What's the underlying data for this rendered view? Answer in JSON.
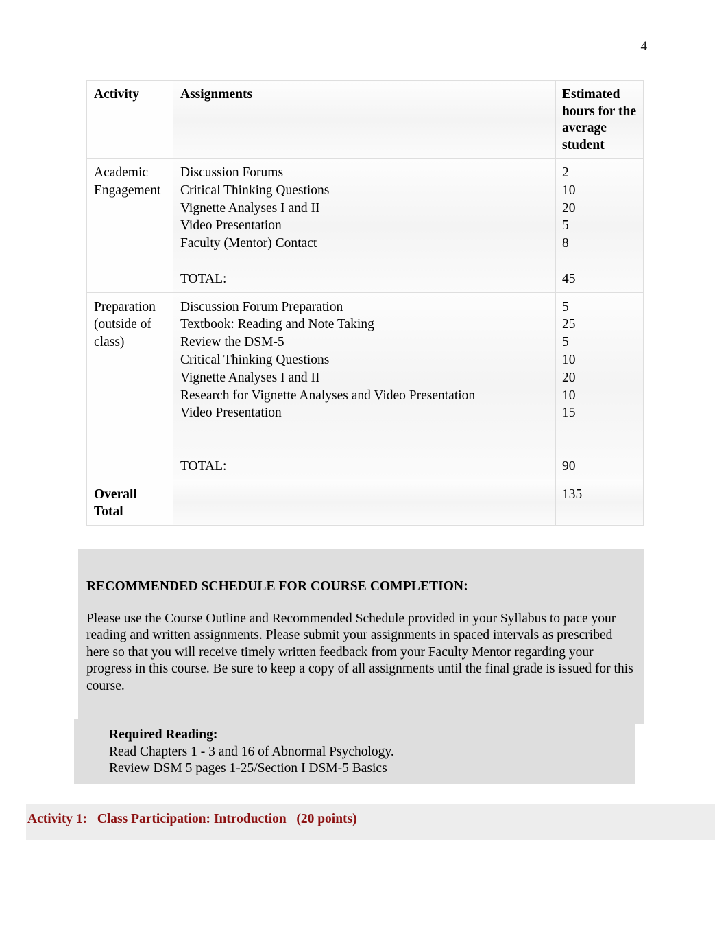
{
  "page": {
    "number": "4"
  },
  "workload_table": {
    "headers": {
      "activity": "Activity",
      "assignments": "Assignments",
      "hours": "Estimated hours for the average student"
    },
    "sections": [
      {
        "activity": "Academic Engagement",
        "bold": false,
        "rows": [
          {
            "assignment": "Discussion Forums",
            "hours": "2"
          },
          {
            "assignment": "Critical Thinking Questions",
            "hours": "10"
          },
          {
            "assignment": "Vignette Analyses I and II",
            "hours": "20"
          },
          {
            "assignment": "Video Presentation",
            "hours": "5"
          },
          {
            "assignment": "Faculty (Mentor) Contact",
            "hours": "8"
          }
        ],
        "total_label": "TOTAL:",
        "total_hours": "45"
      },
      {
        "activity": "Preparation (outside of class)",
        "bold": false,
        "rows": [
          {
            "assignment": "Discussion Forum Preparation",
            "hours": "5"
          },
          {
            "assignment": "Textbook: Reading and Note Taking",
            "hours": "25"
          },
          {
            "assignment": "Review the DSM-5",
            "hours": "5"
          },
          {
            "assignment": "Critical Thinking Questions",
            "hours": "10"
          },
          {
            "assignment": "Vignette Analyses I and II",
            "hours": "20"
          },
          {
            "assignment": "Research for Vignette Analyses and Video Presentation",
            "hours": "10"
          },
          {
            "assignment": "Video Presentation",
            "hours": "15"
          }
        ],
        "total_label": "TOTAL:",
        "total_hours": "90"
      }
    ],
    "overall": {
      "label": "Overall Total",
      "assignments": "",
      "hours": "135"
    }
  },
  "schedule": {
    "heading": "RECOMMENDED SCHEDULE FOR COURSE COMPLETION:",
    "paragraph": "Please use the Course Outline and Recommended Schedule provided in your Syllabus to pace your reading and written assignments.  Please submit your assignments in spaced intervals as prescribed here so that you will receive timely written feedback from your Faculty Mentor regarding your progress in this course. Be sure to keep a copy of all assignments until the final grade is issued for this course."
  },
  "required_reading": {
    "title": "Required Reading:",
    "line1": "Read Chapters 1 - 3 and 16 of Abnormal Psychology.",
    "line2": "Review DSM 5 pages 1-25/Section I DSM-5 Basics"
  },
  "activity_heading": {
    "text": "Activity 1:   Class Participation: Introduction   (20 points)",
    "color": "#8c1111"
  }
}
